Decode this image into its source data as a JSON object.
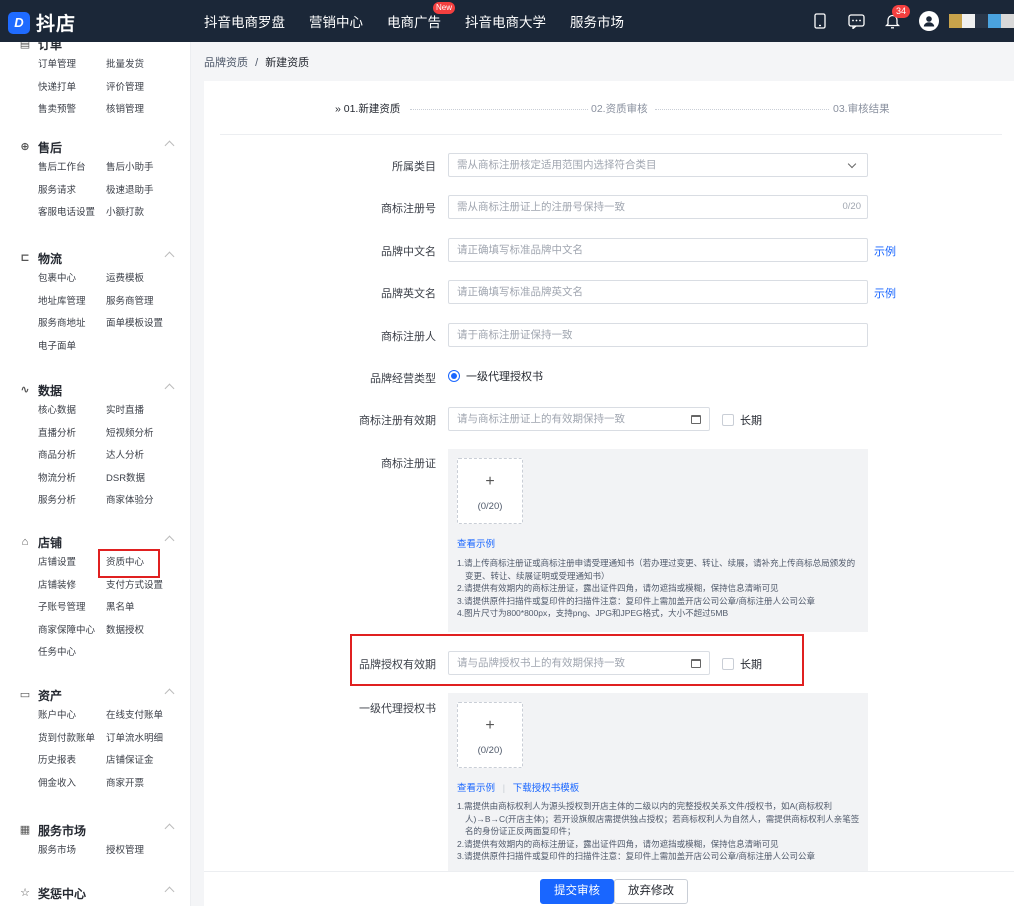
{
  "topbar": {
    "logo_text": "抖店",
    "logo_mark": "D",
    "nav": [
      "抖音电商罗盘",
      "营销中心",
      "电商广告",
      "抖音电商大学",
      "服务市场"
    ],
    "new_badge": "New",
    "notification_count": "34",
    "icons": [
      "phone-icon",
      "message-icon",
      "bell-icon",
      "user-avatar-icon"
    ],
    "color_blocks": [
      "#c8a34b",
      "#f0f0f0",
      "#2a3648",
      "#4aa3df",
      "#d8d8d8"
    ]
  },
  "sidebar": {
    "partial_group": {
      "title": "订单",
      "links": [
        "订单管理",
        "批量发货",
        "快递打单",
        "评价管理",
        "售卖预警",
        "核销管理"
      ]
    },
    "groups": [
      {
        "icon": "after-sales-icon",
        "glyph": "⊕",
        "title": "售后",
        "links": [
          "售后工作台",
          "售后小助手",
          "服务请求",
          "极速退助手",
          "客服电话设置",
          "小额打款"
        ]
      },
      {
        "icon": "logistics-icon",
        "glyph": "⊏",
        "title": "物流",
        "links": [
          "包裹中心",
          "运费模板",
          "地址库管理",
          "服务商管理",
          "服务商地址",
          "面单模板设置",
          "电子面单"
        ]
      },
      {
        "icon": "data-icon",
        "glyph": "∿",
        "title": "数据",
        "links": [
          "核心数据",
          "实时直播",
          "直播分析",
          "短视频分析",
          "商品分析",
          "达人分析",
          "物流分析",
          "DSR数据",
          "服务分析",
          "商家体验分"
        ]
      },
      {
        "icon": "store-icon",
        "glyph": "⌂",
        "title": "店铺",
        "links": [
          "店铺设置",
          "资质中心",
          "店铺装修",
          "支付方式设置",
          "子账号管理",
          "黑名单",
          "商家保障中心",
          "数据授权",
          "任务中心"
        ]
      },
      {
        "icon": "assets-icon",
        "glyph": "▭",
        "title": "资产",
        "links": [
          "账户中心",
          "在线支付账单",
          "货到付款账单",
          "订单流水明细",
          "历史报表",
          "店铺保证金",
          "佣金收入",
          "商家开票"
        ]
      },
      {
        "icon": "service-market-icon",
        "glyph": "▦",
        "title": "服务市场",
        "links": [
          "服务市场",
          "授权管理"
        ]
      },
      {
        "icon": "reward-icon",
        "glyph": "☆",
        "title": "奖惩中心",
        "links": []
      }
    ]
  },
  "breadcrumb": {
    "parent": "品牌资质",
    "sep": "/",
    "current": "新建资质"
  },
  "steps": [
    {
      "label": "» 01.新建资质",
      "active": true
    },
    {
      "label": "02.资质审核",
      "active": false
    },
    {
      "label": "03.审核结果",
      "active": false
    }
  ],
  "form": {
    "category": {
      "label": "所属类目",
      "placeholder": "需从商标注册核定适用范围内选择符合类目"
    },
    "reg_no": {
      "label": "商标注册号",
      "placeholder": "需从商标注册证上的注册号保持一致",
      "count": "0/20"
    },
    "cn_name": {
      "label": "品牌中文名",
      "placeholder": "请正确填写标准品牌中文名",
      "example": "示例"
    },
    "en_name": {
      "label": "品牌英文名",
      "placeholder": "请正确填写标准品牌英文名",
      "example": "示例"
    },
    "registrant": {
      "label": "商标注册人",
      "placeholder": "请于商标注册证保持一致"
    },
    "biz_type": {
      "label": "品牌经营类型",
      "option": "一级代理授权书"
    },
    "reg_validity": {
      "label": "商标注册有效期",
      "placeholder": "请与商标注册证上的有效期保持一致",
      "longterm": "长期"
    },
    "reg_cert": {
      "label": "商标注册证",
      "upload_plus": "+",
      "upload_count": "(0/20)",
      "link": "查看示例",
      "notes": [
        "1.请上传商标注册证或商标注册申请受理通知书（若办理过变更、转让、续展，请补充上传商标总局颁发的变更、转让、续展证明或受理通知书）",
        "2.请提供有效期内的商标注册证，露出证件四角，请勿遮挡或模糊，保持信息清晰可见",
        "3.请提供原件扫描件或复印件的扫描件注意：复印件上需加盖开店公司公章/商标注册人公司公章",
        "4.图片尺寸为800*800px，支持png、JPG和JPEG格式，大小不超过5MB"
      ]
    },
    "auth_validity": {
      "label": "品牌授权有效期",
      "placeholder": "请与品牌授权书上的有效期保持一致",
      "longterm": "长期"
    },
    "auth_letter": {
      "label": "一级代理授权书",
      "upload_plus": "+",
      "upload_count": "(0/20)",
      "link1": "查看示例",
      "link_sep": "|",
      "link2": "下载授权书模板",
      "notes": [
        "1.需提供由商标权利人为源头授权到开店主体的二级以内的完整授权关系文件/授权书，如A(商标权利人)→B→C(开店主体)；若开设旗舰店需提供独占授权；若商标权利人为自然人，需提供商标权利人亲笔签名的身份证正反两面复印件；",
        "2.请提供有效期内的商标注册证，露出证件四角，请勿遮挡或模糊，保持信息清晰可见",
        "3.请提供原件扫描件或复印件的扫描件注意：复印件上需加盖开店公司公章/商标注册人公司公章"
      ]
    }
  },
  "footer": {
    "submit": "提交审核",
    "discard": "放弃修改"
  }
}
